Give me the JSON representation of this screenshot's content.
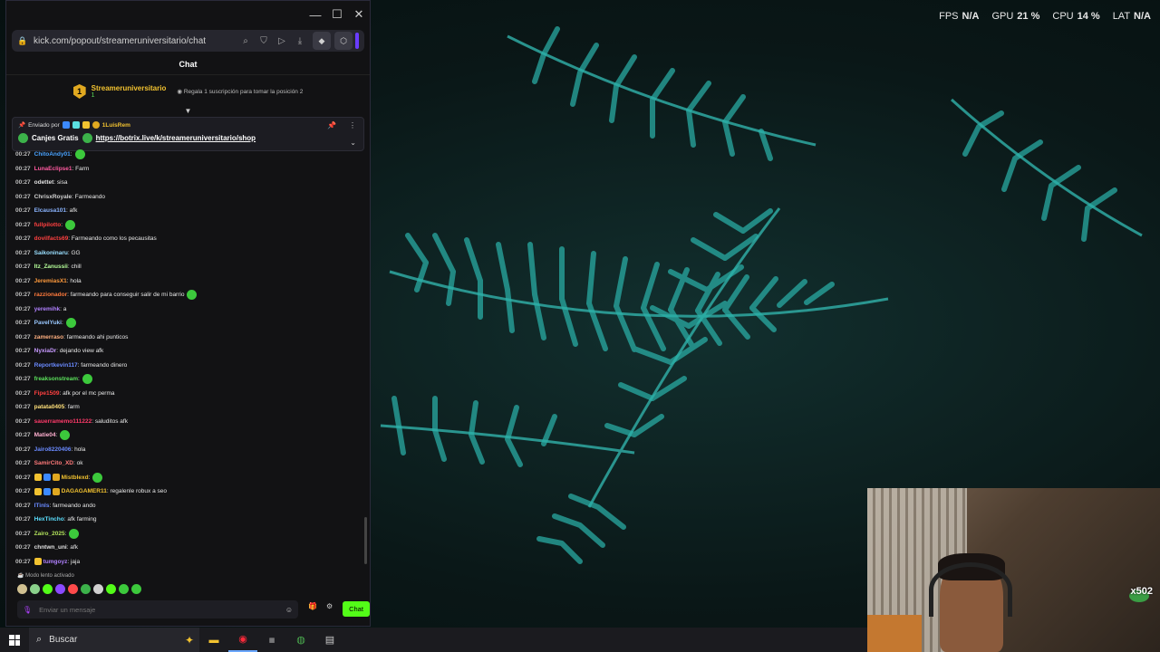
{
  "perf": [
    {
      "label": "FPS",
      "value": "N/A"
    },
    {
      "label": "GPU",
      "value": "21 %"
    },
    {
      "label": "CPU",
      "value": "14 %"
    },
    {
      "label": "LAT",
      "value": "N/A"
    }
  ],
  "browser": {
    "url": "kick.com/popout/streameruniversitario/chat",
    "chat_title": "Chat"
  },
  "leaderboard": {
    "rank": "1",
    "name": "Streameruniversitario",
    "count": "1",
    "gift_text": "Regala 1 suscripción para tomar la posición 2"
  },
  "pinned": {
    "sent_by": "Enviado por",
    "user": "1LuisRem",
    "prefix": "Canjes Gratis",
    "link": "https://botrix.live/k/streameruniversitario/shop"
  },
  "messages": [
    {
      "time": "00:27",
      "user": "ChitoAndy01",
      "color": "#4aa3ff",
      "text": ":",
      "emote": true
    },
    {
      "time": "00:27",
      "user": "LunaEclipse1",
      "color": "#ff5aa0",
      "text": ": Farm"
    },
    {
      "time": "00:27",
      "user": "odettet",
      "color": "#e0e0e0",
      "text": ": sisa"
    },
    {
      "time": "00:27",
      "user": "ChrisxRoyale",
      "color": "#d0d0d0",
      "text": ": Farmeando"
    },
    {
      "time": "00:27",
      "user": "Elcausa101",
      "color": "#8ab4ff",
      "text": ": afk"
    },
    {
      "time": "00:27",
      "user": "fullpilotto",
      "color": "#ff4040",
      "text": ":",
      "emote": true
    },
    {
      "time": "00:27",
      "user": "dovilfacts69",
      "color": "#ff4040",
      "text": ": Farmeando como los pecausitas"
    },
    {
      "time": "00:27",
      "user": "Saikoninaru",
      "color": "#9adfff",
      "text": ": GG"
    },
    {
      "time": "00:27",
      "user": "Itz_Zanussii",
      "color": "#b6ff9a",
      "text": ": chill"
    },
    {
      "time": "00:27",
      "user": "JeremiasX1",
      "color": "#ff9a3c",
      "text": ": hola"
    },
    {
      "time": "00:27",
      "user": "razzionador",
      "color": "#ff7a3c",
      "text": ": farmeando para conseguir salir de mi barrio",
      "emote": true
    },
    {
      "time": "00:27",
      "user": "yeremihk",
      "color": "#b080ff",
      "text": ": a"
    },
    {
      "time": "00:27",
      "user": "PavelYuki",
      "color": "#9ac8ff",
      "text": ":",
      "emote": true
    },
    {
      "time": "00:27",
      "user": "zamerraso",
      "color": "#ffb080",
      "text": ": farmeando ahi punticos"
    },
    {
      "time": "00:27",
      "user": "NyxiaDr",
      "color": "#c89aff",
      "text": ": dejando view afk"
    },
    {
      "time": "00:27",
      "user": "Reportkevin117",
      "color": "#6a8aff",
      "text": ": farmeando dinero"
    },
    {
      "time": "00:27",
      "user": "freaksonstream",
      "color": "#5be05b",
      "text": ":",
      "emote": true
    },
    {
      "time": "00:27",
      "user": "Fipe1509",
      "color": "#ff4040",
      "text": ": afk por el mc perma"
    },
    {
      "time": "00:27",
      "user": "patata0405",
      "color": "#ffe07a",
      "text": ": farm"
    },
    {
      "time": "00:27",
      "user": "sauerramemo111222",
      "color": "#ff3a6a",
      "text": ": saluditos afk"
    },
    {
      "time": "00:27",
      "user": "Matie04",
      "color": "#ffb0d0",
      "text": ":",
      "emote": true
    },
    {
      "time": "00:27",
      "user": "Jairo8220406",
      "color": "#6a8aff",
      "text": ": hola"
    },
    {
      "time": "00:27",
      "user": "SamirCito_XD",
      "color": "#ff7a7a",
      "text": ": ok"
    },
    {
      "time": "00:27",
      "user": "Mistblexd",
      "color": "#f2c230",
      "text": ":",
      "emote": true,
      "badges": 3
    },
    {
      "time": "00:27",
      "user": "DAGAGAMER11",
      "color": "#f2c230",
      "text": ": regalenle robux a seo",
      "badges": 3
    },
    {
      "time": "00:27",
      "user": "ITinls",
      "color": "#6a8aff",
      "text": ": farmeando ando"
    },
    {
      "time": "00:27",
      "user": "HexTincho",
      "color": "#5be0ff",
      "text": ": afk farming"
    },
    {
      "time": "00:27",
      "user": "Zairo_2025",
      "color": "#b0e05b",
      "text": ":",
      "emote": true
    },
    {
      "time": "00:27",
      "user": "chntwn_uni",
      "color": "#e0e0e0",
      "text": ": afk"
    },
    {
      "time": "00:27",
      "user": "tumgoyz",
      "color": "#b080ff",
      "text": ": jaja",
      "badges": 1
    }
  ],
  "footer": {
    "slow_mode": "Modo lento activado",
    "input_placeholder": "Enviar un mensaje",
    "chat_button": "Chat"
  },
  "webcam": {
    "counter": "x502"
  },
  "taskbar": {
    "search_placeholder": "Buscar"
  }
}
